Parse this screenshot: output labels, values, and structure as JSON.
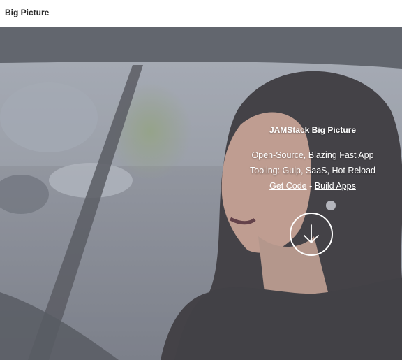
{
  "header": {
    "brand": "Big Picture"
  },
  "hero": {
    "title": "JAMStack Big Picture",
    "lines": [
      "Open-Source, Blazing Fast App",
      "Tooling: Gulp, SaaS, Hot Reload"
    ],
    "link_get_code": "Get Code",
    "separator": "-",
    "link_build_apps": "Build Apps",
    "scroll_icon": "arrow-down-icon"
  },
  "colors": {
    "header_bg": "#ffffff",
    "brand_text": "#2a2a2a",
    "hero_text": "#ffffff",
    "hero_overlay": "#7c818b"
  }
}
